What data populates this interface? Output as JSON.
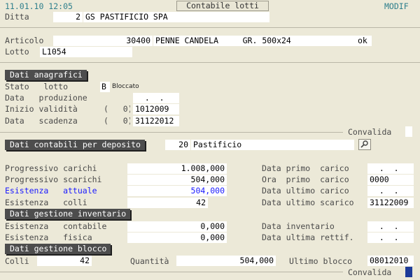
{
  "header": {
    "datetime": "11.01.10 12:05",
    "title_button": "Contabile lotti",
    "mode": "MODIF"
  },
  "ditta": {
    "label": "Ditta",
    "code": "2",
    "name": "GS PASTIFICIO SPA"
  },
  "articolo": {
    "label": "Articolo",
    "code": "30400",
    "description": "PENNE CANDELA     GR. 500x24",
    "status": "ok"
  },
  "lotto": {
    "label": "Lotto",
    "value": "L1054"
  },
  "anagrafici": {
    "title": "Dati anagrafici",
    "stato_label": "Stato   lotto",
    "stato_code": "B",
    "stato_text": "Bloccato",
    "produzione_label": "Data   produzione",
    "produzione_value": "  .  .    0",
    "validita_label": "Inizio validità",
    "validita_paren": "(   0)",
    "validita_value": "1012009",
    "scadenza_label": "Data   scadenza",
    "scadenza_paren": "(   0)",
    "scadenza_value": "31122012",
    "convalida_label": "Convalida"
  },
  "contabili": {
    "title": "Dati contabili per deposito",
    "deposito_code": "20",
    "deposito_name": "Pastificio",
    "rows_left": [
      {
        "label": "Progressivo carichi",
        "value": "1.008,000"
      },
      {
        "label": "Progressivo scarichi",
        "value": "504,000"
      },
      {
        "label": "Esistenza   attuale",
        "value": "504,000"
      },
      {
        "label": "Esistenza   colli",
        "value": "42"
      }
    ],
    "rows_right": [
      {
        "label": "Data primo  carico",
        "value": "  .  .    0"
      },
      {
        "label": "Ora  primo  carico",
        "value": "0000"
      },
      {
        "label": "Data ultimo carico",
        "value": "  .  .    0"
      },
      {
        "label": "Data ultimo scarico",
        "value": "31122009"
      }
    ]
  },
  "inventario": {
    "title": "Dati gestione inventario",
    "contabile_label": "Esistenza   contabile",
    "contabile_value": "0,000",
    "fisica_label": "Esistenza   fisica",
    "fisica_value": "0,000",
    "data_inv_label": "Data inventario",
    "data_inv_value": "  .  .    0",
    "data_rett_label": "Data ultima rettif.",
    "data_rett_value": "  .  .    0"
  },
  "blocco": {
    "title": "Dati gestione blocco",
    "colli_label": "Colli",
    "colli_value": "42",
    "quantita_label": "Quantità",
    "quantita_value": "504,000",
    "ultimo_label": "Ultimo blocco",
    "ultimo_value": "08012010",
    "convalida_label": "Convalida",
    "convalida_checked": true
  }
}
